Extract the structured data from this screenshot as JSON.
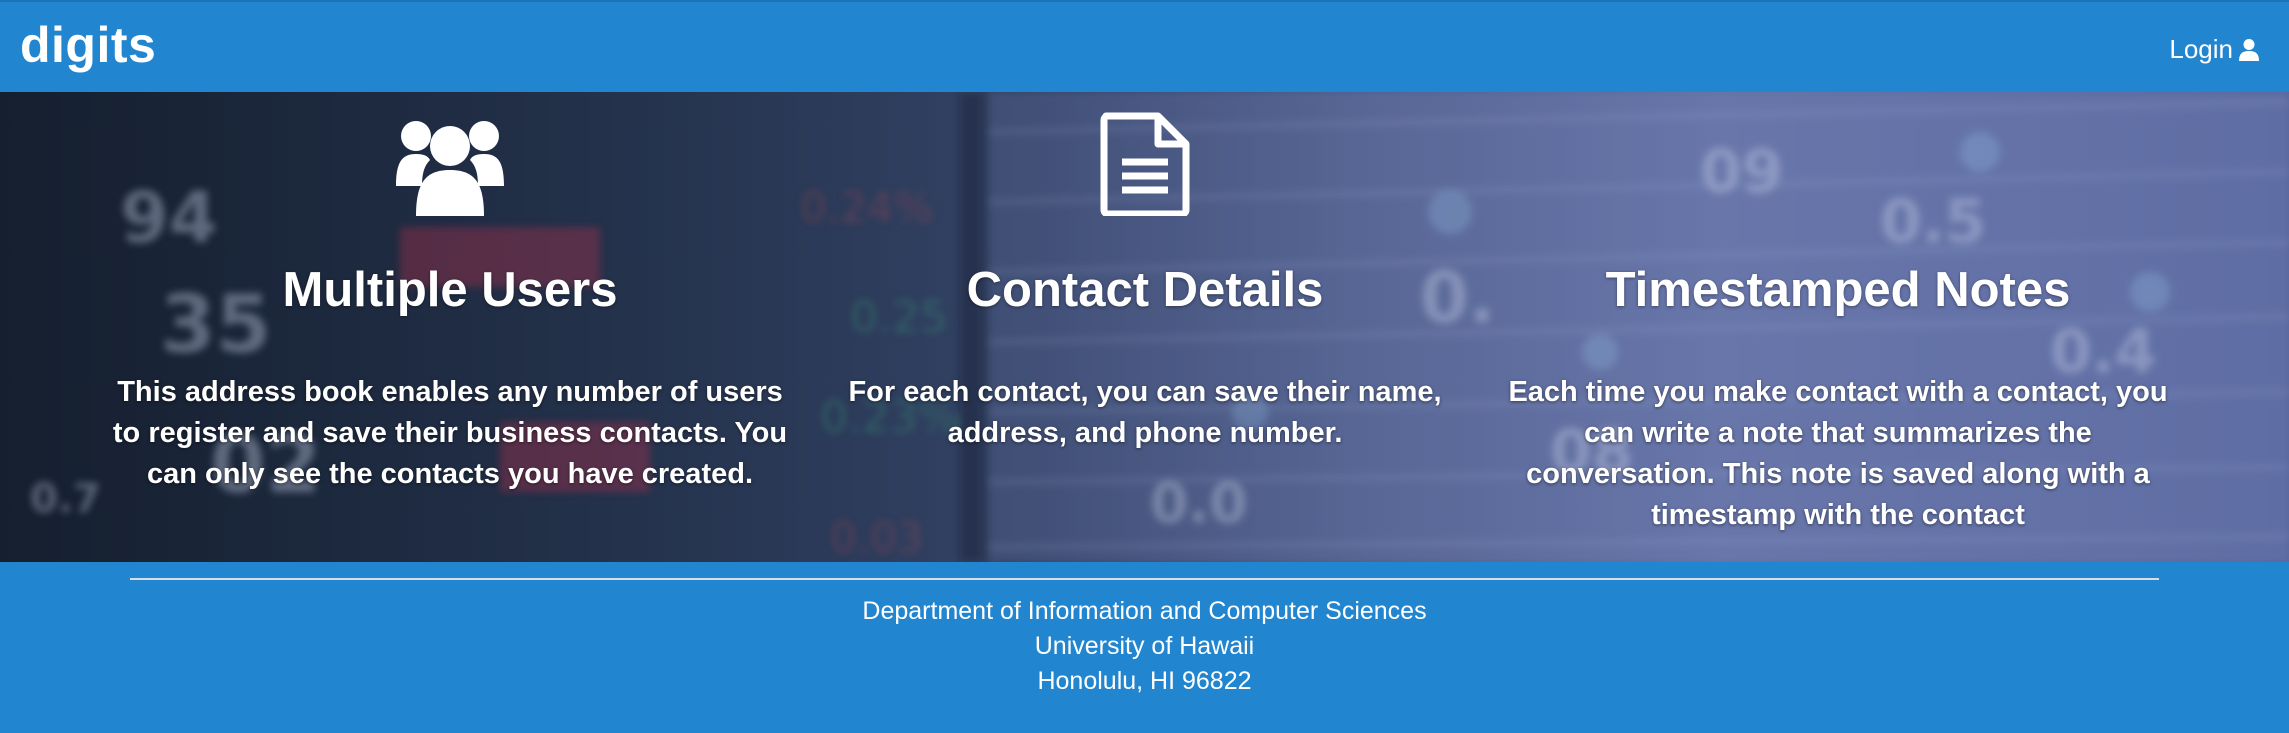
{
  "navbar": {
    "brand": "digits",
    "login_label": "Login",
    "login_icon": "user-icon"
  },
  "features": [
    {
      "icon": "users-icon",
      "title": "Multiple Users",
      "description": "This address book enables any number of users to register and save their business contacts. You can only see the contacts you have created."
    },
    {
      "icon": "file-text-icon",
      "title": "Contact Details",
      "description": "For each contact, you can save their name, address, and phone number."
    },
    {
      "icon": "",
      "title": "Timestamped Notes",
      "description": "Each time you make contact with a contact, you can write a note that summarizes the conversation. This note is saved along with a timestamp with the contact"
    }
  ],
  "footer": {
    "line1": "Department of Information and Computer Sciences",
    "line2": "University of Hawaii",
    "line3": "Honolulu, HI 96822"
  },
  "colors": {
    "primary": "#2185d0",
    "text": "#ffffff",
    "divider": "#d6dde6"
  }
}
